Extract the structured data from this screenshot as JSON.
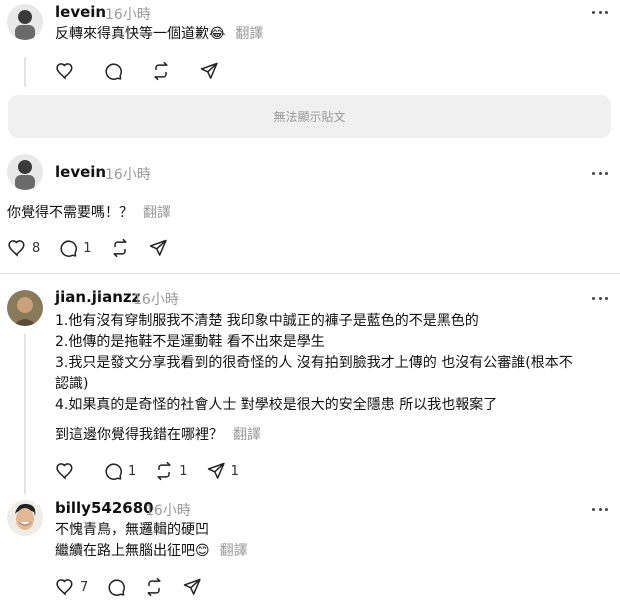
{
  "comments": [
    {
      "username": "levein",
      "time": "16小時",
      "text": "反轉來得真快等一個道歉😂",
      "translate": "翻譯",
      "likes": "",
      "replies": "",
      "reposts": "",
      "shares": ""
    },
    {
      "username": "levein",
      "time": "16小時",
      "text": "你覺得不需要嗎！？",
      "translate": "翻譯",
      "likes": "8",
      "replies": "1",
      "reposts": "",
      "shares": ""
    },
    {
      "username": "jian.jianzz",
      "time": "16小時",
      "lines": [
        "1.他有沒有穿制服我不清楚 我印象中誠正的褲子是藍色的不是黑色的",
        "2.他傳的是拖鞋不是運動鞋 看不出來是學生",
        "3.我只是發文分享我看到的很奇怪的人 沒有拍到臉我才上傳的 也沒有公審誰(根本不",
        "認識)",
        "4.如果真的是奇怪的社會人士 對學校是很大的安全隱患 所以我也報案了"
      ],
      "text": "到這邊你覺得我錯在哪裡？",
      "translate": "翻譯",
      "likes": "",
      "replies": "1",
      "reposts": "1",
      "shares": "1"
    },
    {
      "username": "billy542680",
      "time": "16小時",
      "lines": [
        "不愧青鳥，無邏輯的硬凹"
      ],
      "text": "繼續在路上無腦出征吧😊",
      "translate": "翻譯",
      "likes": "7",
      "replies": "",
      "reposts": "",
      "shares": ""
    }
  ],
  "unavailable_post": "無法顯示貼文",
  "icons": {
    "like": "heart-icon",
    "reply": "comment-icon",
    "repost": "repost-icon",
    "share": "send-icon",
    "more": "more-options-icon"
  }
}
